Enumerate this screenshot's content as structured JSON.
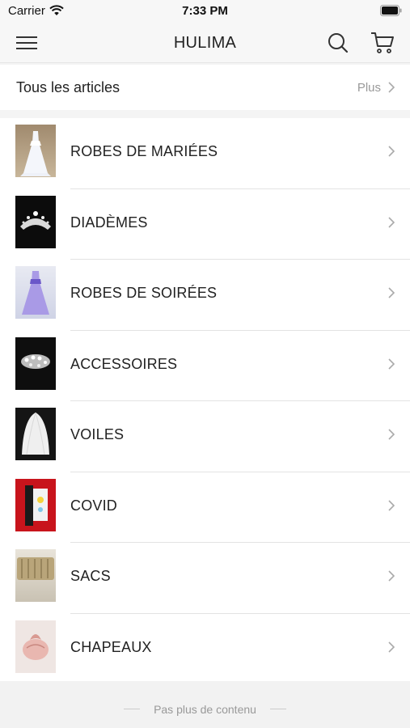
{
  "status_bar": {
    "carrier": "Carrier",
    "time": "7:33 PM"
  },
  "navbar": {
    "title": "HULIMA"
  },
  "all_articles": {
    "label": "Tous les articles",
    "more_label": "Plus"
  },
  "categories": [
    {
      "name": "ROBES DE MARIÉES"
    },
    {
      "name": "DIADÈMES"
    },
    {
      "name": "ROBES DE SOIRÉES"
    },
    {
      "name": "ACCESSOIRES"
    },
    {
      "name": "VOILES"
    },
    {
      "name": "COVID"
    },
    {
      "name": "SACS"
    },
    {
      "name": "CHAPEAUX"
    }
  ],
  "footer": {
    "text": "Pas plus de contenu"
  },
  "colors": {
    "background": "#f4f4f4",
    "text": "#222222",
    "muted": "#999999",
    "separator": "#e3e3e3"
  }
}
